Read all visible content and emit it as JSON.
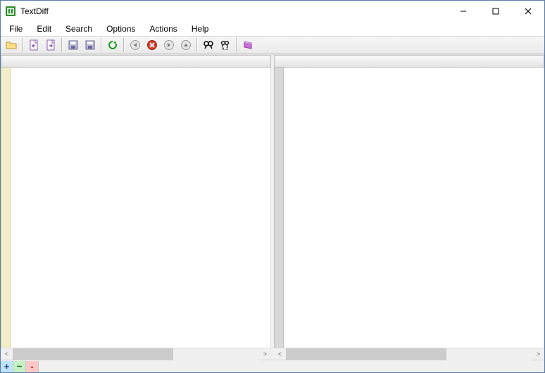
{
  "title": "TextDiff",
  "window_controls": {
    "minimize": "–",
    "maximize": "☐",
    "close": "✕"
  },
  "menu": [
    "File",
    "Edit",
    "Search",
    "Options",
    "Actions",
    "Help"
  ],
  "toolbar": [
    {
      "name": "open-folder-icon",
      "hint": "Open"
    },
    {
      "name": "file-left-icon",
      "hint": "Open left"
    },
    {
      "name": "file-right-icon",
      "hint": "Open right"
    },
    {
      "name": "save-left-icon",
      "hint": "Save left"
    },
    {
      "name": "save-right-icon",
      "hint": "Save right"
    },
    {
      "name": "refresh-icon",
      "hint": "Recompare"
    },
    {
      "name": "prev-diff-icon",
      "hint": "Previous diff"
    },
    {
      "name": "cancel-icon",
      "hint": "Cancel"
    },
    {
      "name": "next-diff-icon",
      "hint": "Next diff"
    },
    {
      "name": "up-icon",
      "hint": "Up"
    },
    {
      "name": "find-icon",
      "hint": "Find"
    },
    {
      "name": "find-next-icon",
      "hint": "Find next"
    },
    {
      "name": "help-book-icon",
      "hint": "Help"
    }
  ],
  "status": {
    "added": "+",
    "changed": "~",
    "removed": "-"
  },
  "panes": {
    "left": {
      "header": ""
    },
    "right": {
      "header": ""
    }
  },
  "scroll": {
    "left_glyph": "<",
    "right_glyph": ">"
  }
}
